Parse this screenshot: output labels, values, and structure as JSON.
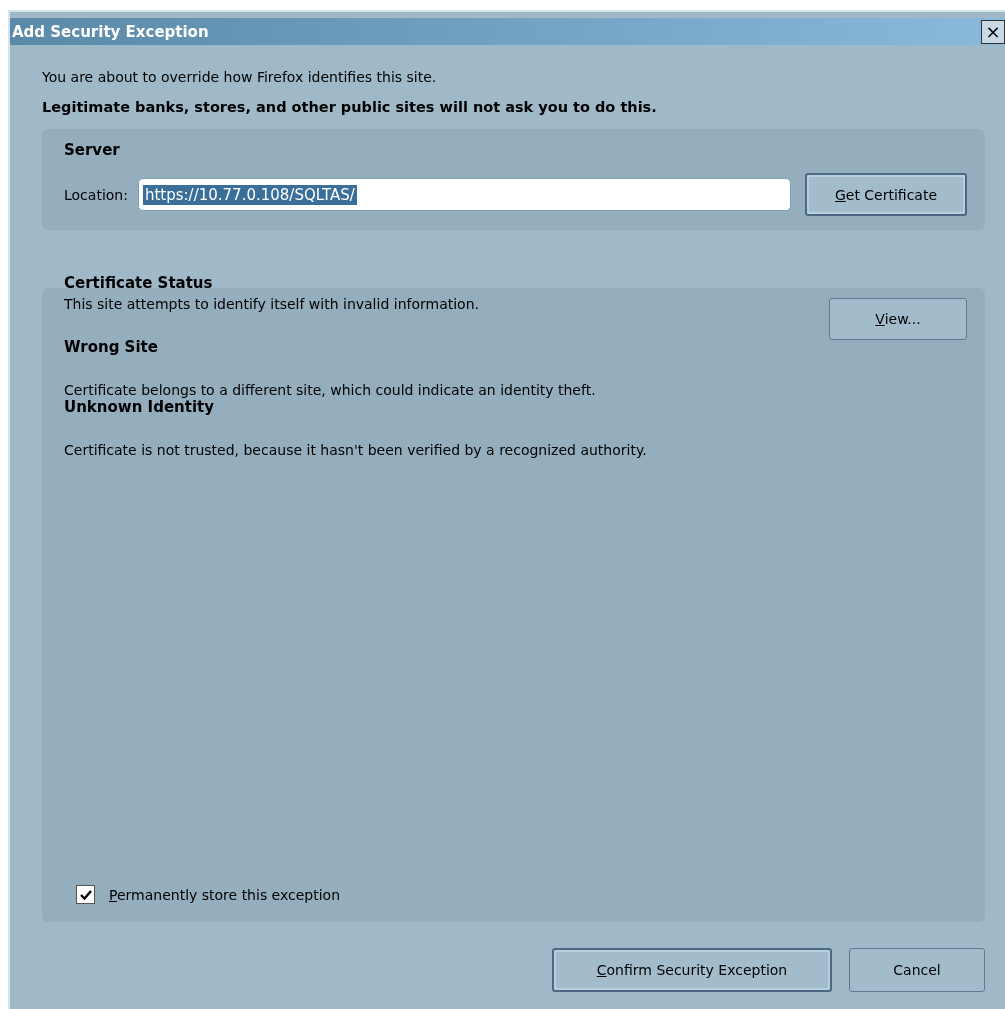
{
  "window": {
    "title": "Add Security Exception",
    "close": "×"
  },
  "intro": "You are about to override how Firefox identifies this site.",
  "warning": "Legitimate banks, stores, and other public sites will not ask you to do this.",
  "server": {
    "heading": "Server",
    "location_label": "Location:",
    "location_value": "https://10.77.0.108/SQLTAS/",
    "value_selected": true,
    "button": {
      "label": "Get Certificate",
      "access_first": true,
      "focused": true
    }
  },
  "certificate_status": {
    "heading": "Certificate Status",
    "summary": "This site attempts to identify itself with invalid information.",
    "view_button": {
      "label": "View...",
      "access_first": true,
      "focused": false
    },
    "problems": [
      {
        "title": "Wrong Site",
        "description": "Certificate belongs to a different site, which could indicate an identity theft."
      },
      {
        "title": "Unknown Identity",
        "description": "Certificate is not trusted, because it hasn't been verified by a recognized authority."
      }
    ],
    "permanent": {
      "label": "Permanently store this exception",
      "access_first": true,
      "checked": true
    }
  },
  "buttons": [
    {
      "label": "Confirm Security Exception",
      "access_first": true,
      "focused": true
    },
    {
      "label": "Cancel",
      "access_first": false,
      "focused": false
    }
  ]
}
